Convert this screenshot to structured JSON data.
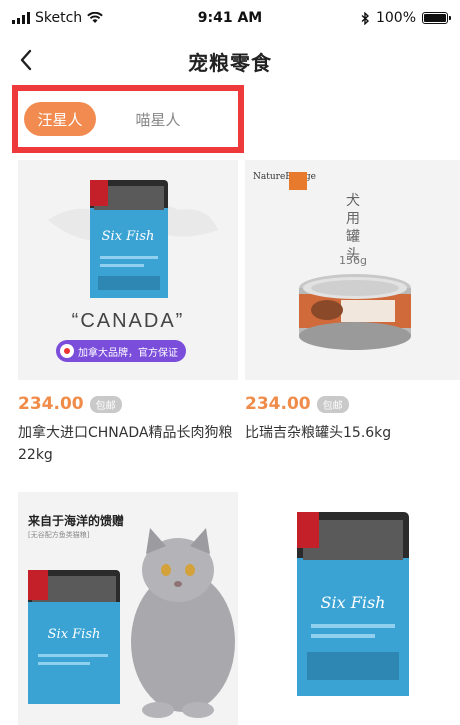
{
  "status_bar": {
    "carrier": "Sketch",
    "time": "9:41 AM",
    "battery": "100%"
  },
  "nav": {
    "back_icon": "chevron-left-icon",
    "title": "宠粮零食"
  },
  "tabs": [
    {
      "label": "汪星人",
      "active": true
    },
    {
      "label": "喵星人",
      "active": false
    }
  ],
  "colors": {
    "accent": "#f28b50",
    "price": "#f08c4a",
    "highlight_border": "#ee3a3a",
    "badge": "#7b4ddb"
  },
  "products": [
    {
      "price": "234.00",
      "tag": "包邮",
      "name": "加拿大进口CHNADA精品长肉狗粮 22kg",
      "image_caption": "“CANADA”",
      "badge": "加拿大品牌，官方保证"
    },
    {
      "price": "234.00",
      "tag": "包邮",
      "name": "比瑞吉杂粮罐头15.6kg",
      "brand": "NatureBridge",
      "image_caption": "犬用罐头",
      "image_size": "156g"
    },
    {
      "image_title": "来自于海洋的馈赠",
      "image_subtitle": "[无谷配方鱼类猫粮]",
      "pack_label": "Six Fish"
    },
    {
      "pack_label": "Six Fish"
    }
  ]
}
